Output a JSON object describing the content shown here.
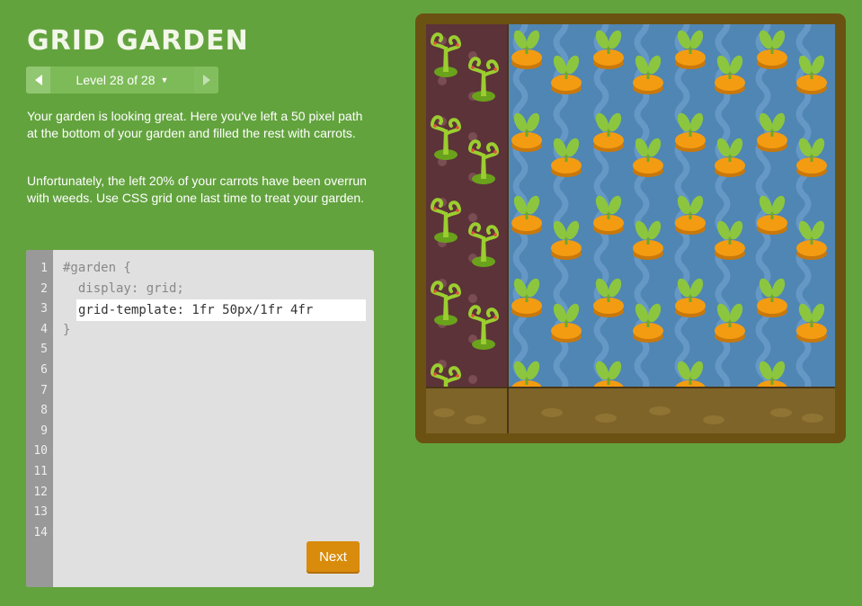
{
  "app": {
    "title": "GRID GARDEN"
  },
  "level_nav": {
    "label": "Level 28 of 28",
    "prev_icon": "arrow-left-icon",
    "next_icon": "arrow-right-icon",
    "dropdown_icon": "caret-down-icon"
  },
  "instructions": {
    "p1": "Your garden is looking great. Here you've left a 50 pixel path at the bottom of your garden and filled the rest with carrots.",
    "p2": "Unfortunately, the left 20% of your carrots have been overrun with weeds. Use CSS grid one last time to treat your garden."
  },
  "editor": {
    "line_numbers": [
      "1",
      "2",
      "3",
      "4",
      "5",
      "6",
      "7",
      "8",
      "9",
      "10",
      "11",
      "12",
      "13",
      "14"
    ],
    "line1": "#garden {",
    "line2": "  display: grid;",
    "input_value": "grid-template: 1fr 50px/1fr 4fr",
    "line4": "}",
    "next_label": "Next"
  },
  "colors": {
    "background": "#63a33e",
    "frame": "#6b5212",
    "water": "#4f86b3",
    "weeds_bed": "#5c3339",
    "path": "#7e6428",
    "carrot": "#f39c12",
    "leaf": "#8cc63f",
    "weed": "#9bce2f"
  }
}
